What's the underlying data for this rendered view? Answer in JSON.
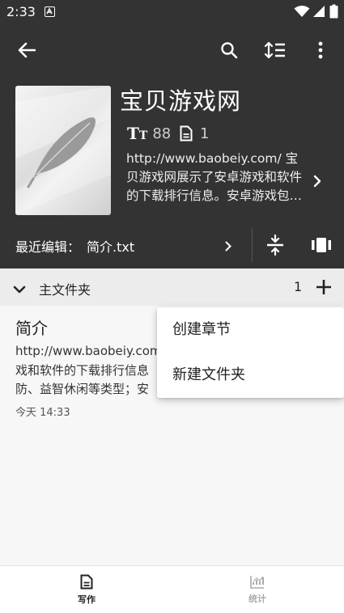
{
  "status_bar": {
    "time": "2:33"
  },
  "book": {
    "title": "宝贝游戏网",
    "word_count": "88",
    "chapter_count": "1",
    "description": "http://www.baobeiy.com/ 宝贝游戏网展示了安卓游戏和软件的下载排行信息。安卓游戏包括动作冒险、角色扮演、模拟经营、飞行射击、塔防、益智休闲等类型；安卓软件包括..."
  },
  "recent_edit": {
    "label": "最近编辑：",
    "file": "简介.txt"
  },
  "folder": {
    "name": "主文件夹",
    "count": "1"
  },
  "chapter": {
    "title": "简介",
    "lines": [
      "http://www.baobeiy.com",
      "戏和软件的下载排行信息",
      "防、益智休闲等类型；安"
    ],
    "time": "今天 14:33"
  },
  "popup_menu": {
    "items": [
      "创建章节",
      "新建文件夹"
    ]
  },
  "bottom_nav": {
    "items": [
      {
        "label": "写作",
        "active": true
      },
      {
        "label": "统计",
        "active": false
      }
    ]
  },
  "colors": {
    "header_bg": "#333333",
    "accent_active": "#222222",
    "inactive": "#aaaaaa"
  }
}
